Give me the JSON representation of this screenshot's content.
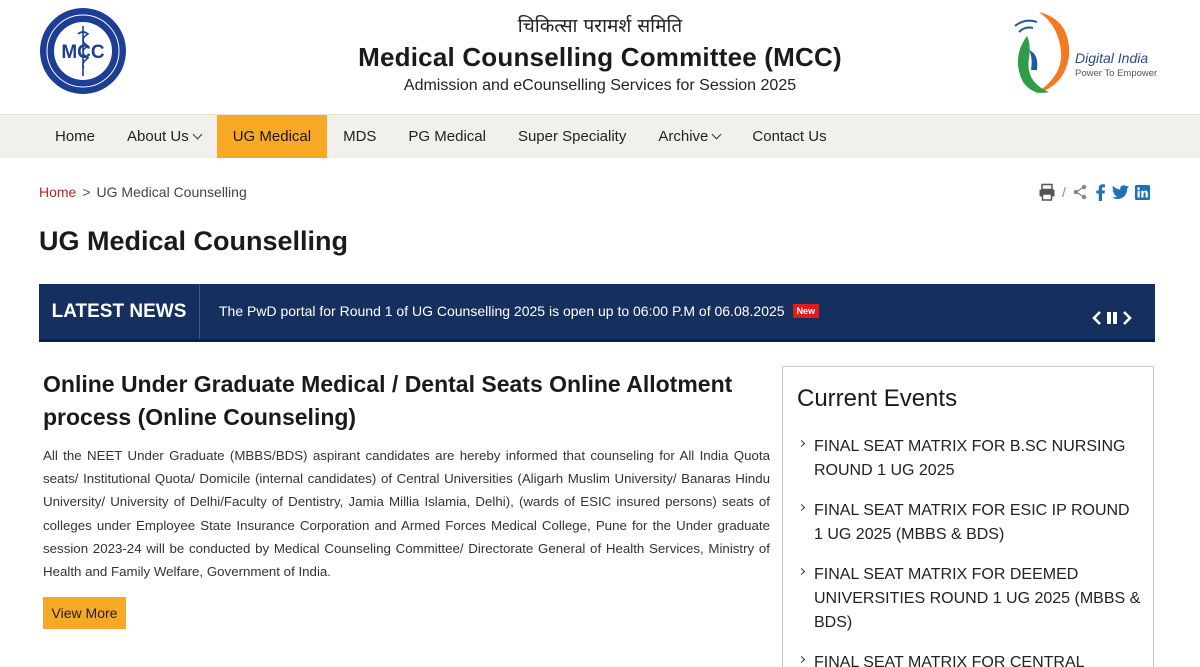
{
  "header": {
    "hindi_title": "चिकित्सा परामर्श समिति",
    "title": "Medical Counselling Committee (MCC)",
    "subtitle": "Admission and eCounselling Services for Session 2025",
    "mcc_logo_text": "MCC",
    "digital_india_name": "Digital India",
    "digital_india_tagline": "Power To Empower"
  },
  "nav": {
    "items": [
      {
        "label": "Home"
      },
      {
        "label": "About Us"
      },
      {
        "label": "UG Medical"
      },
      {
        "label": "MDS"
      },
      {
        "label": "PG Medical"
      },
      {
        "label": "Super Speciality"
      },
      {
        "label": "Archive"
      },
      {
        "label": "Contact Us"
      }
    ],
    "active": "UG Medical"
  },
  "breadcrumb": {
    "home": "Home",
    "separator": ">",
    "current": "UG Medical Counselling"
  },
  "page_title": "UG Medical Counselling",
  "news": {
    "label": "LATEST NEWS",
    "text": "The PwD portal for Round 1 of UG Counselling 2025 is open up to 06:00 P.M of 06.08.2025",
    "badge": "New"
  },
  "main": {
    "heading": "Online Under Graduate Medical / Dental Seats Online Allotment process (Online Counseling)",
    "body": "All the NEET Under Graduate (MBBS/BDS) aspirant candidates are hereby informed that counseling for All India Quota seats/ Institutional Quota/ Domicile (internal candidates) of Central Universities (Aligarh Muslim University/ Banaras Hindu University/ University of Delhi/Faculty of Dentistry, Jamia Millia Islamia, Delhi), (wards of ESIC insured persons) seats of colleges under Employee State Insurance Corporation and Armed Forces Medical College, Pune for the Under graduate session 2023-24 will be conducted by Medical Counseling Committee/ Directorate General of Health Services, Ministry of Health and Family Welfare, Government of India.",
    "view_more": "View More"
  },
  "events": {
    "title": "Current Events",
    "items": [
      {
        "text": "FINAL SEAT MATRIX FOR B.SC NURSING ROUND 1 UG 2025"
      },
      {
        "text": "FINAL SEAT MATRIX FOR ESIC IP ROUND 1 UG 2025 (MBBS & BDS)"
      },
      {
        "text": "FINAL SEAT MATRIX FOR DEEMED UNIVERSITIES ROUND 1 UG 2025 (MBBS & BDS)"
      },
      {
        "text": "FINAL SEAT MATRIX FOR CENTRAL"
      }
    ]
  },
  "colors": {
    "nav_active": "#f7a825",
    "news_bg": "#15305e",
    "breadcrumb_home": "#b02a1f",
    "badge_red": "#e21b1b",
    "share_blue": "#1a73b8"
  },
  "icons": [
    "print-icon",
    "share-icon",
    "facebook-icon",
    "twitter-icon",
    "linkedin-icon",
    "prev-icon",
    "pause-icon",
    "next-icon"
  ]
}
